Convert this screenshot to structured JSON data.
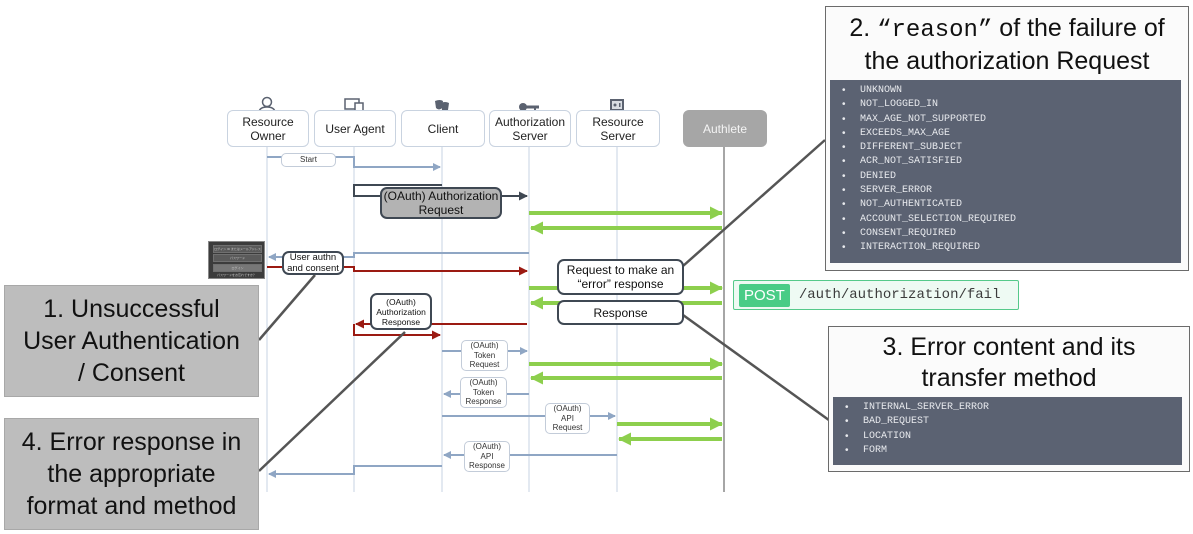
{
  "actors": [
    {
      "name": "Resource Owner",
      "line1": "Resource",
      "line2": "Owner",
      "icon": "person-icon"
    },
    {
      "name": "User Agent",
      "line1": "User Agent",
      "line2": "",
      "icon": "devices-icon"
    },
    {
      "name": "Client",
      "line1": "Client",
      "line2": "",
      "icon": "theater-masks-icon"
    },
    {
      "name": "Authorization Server",
      "line1": "Authorization",
      "line2": "Server",
      "icon": "key-icon"
    },
    {
      "name": "Resource Server",
      "line1": "Resource",
      "line2": "Server",
      "icon": "safe-icon"
    },
    {
      "name": "Authlete",
      "line1": "Authlete",
      "line2": "",
      "icon": ""
    }
  ],
  "messages": {
    "start": "Start",
    "authz_request": [
      "(OAuth) Authorization",
      "Request"
    ],
    "user_authn": [
      "User authn",
      "and consent"
    ],
    "authz_response": [
      "(OAuth)",
      "Authorization",
      "Response"
    ],
    "fail_request": [
      "Request to make an",
      "“error” response"
    ],
    "fail_response": "Response",
    "token_request": [
      "(OAuth)",
      "Token",
      "Request"
    ],
    "token_response": [
      "(OAuth)",
      "Token",
      "Response"
    ],
    "api_request": [
      "(OAuth)",
      "API",
      "Request"
    ],
    "api_response": [
      "(OAuth)",
      "API",
      "Response"
    ]
  },
  "login_screenshot": {
    "field1": "ログイン ID またはメールアドレス",
    "field2": "パスワード",
    "button": "ログイン",
    "link": "パスワードをお忘れですか？"
  },
  "endpoint": {
    "method": "POST",
    "path": "/auth/authorization/fail"
  },
  "callouts": {
    "c1": [
      "1. Unsuccessful",
      "User Authentication",
      "/ Consent"
    ],
    "c4": [
      "4. Error response in",
      "the appropriate",
      "format and method"
    ]
  },
  "panel2": {
    "title_prefix": "2. ",
    "title_code": "“reason”",
    "title_suffix": " of the failure of",
    "title_line2": "the authorization Request",
    "reasons": [
      "UNKNOWN",
      "NOT_LOGGED_IN",
      "MAX_AGE_NOT_SUPPORTED",
      "EXCEEDS_MAX_AGE",
      "DIFFERENT_SUBJECT",
      "ACR_NOT_SATISFIED",
      "DENIED",
      "SERVER_ERROR",
      "NOT_AUTHENTICATED",
      "ACCOUNT_SELECTION_REQUIRED",
      "CONSENT_REQUIRED",
      "INTERACTION_REQUIRED"
    ]
  },
  "panel3": {
    "title_line1": "3. Error content and its",
    "title_line2": "transfer method",
    "actions": [
      "INTERNAL_SERVER_ERROR",
      "BAD_REQUEST",
      "LOCATION",
      "FORM"
    ]
  },
  "colors": {
    "lifeline": "#c7d3e3",
    "blue_arrow": "#8fa6c4",
    "dark_arrow": "#3f4853",
    "red_arrow": "#9b1a12",
    "green_arrow": "#8dcf4d",
    "authlete_line": "#a6a6a6",
    "leader": "#555555"
  }
}
